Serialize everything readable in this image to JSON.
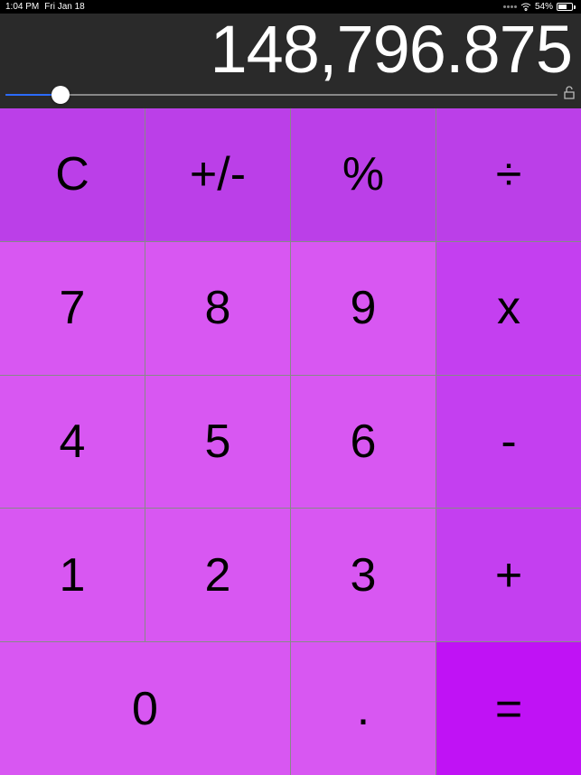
{
  "statusbar": {
    "time": "1:04 PM",
    "date": "Fri Jan 18",
    "battery_percent": "54%",
    "battery_fill_pct": 54
  },
  "display": {
    "value": "148,796.875",
    "slider_pct": 10
  },
  "keys": {
    "clear": "C",
    "sign": "+/-",
    "percent": "%",
    "divide": "÷",
    "seven": "7",
    "eight": "8",
    "nine": "9",
    "multiply": "x",
    "four": "4",
    "five": "5",
    "six": "6",
    "minus": "-",
    "one": "1",
    "two": "2",
    "three": "3",
    "plus": "+",
    "zero": "0",
    "decimal": ".",
    "equals": "="
  }
}
